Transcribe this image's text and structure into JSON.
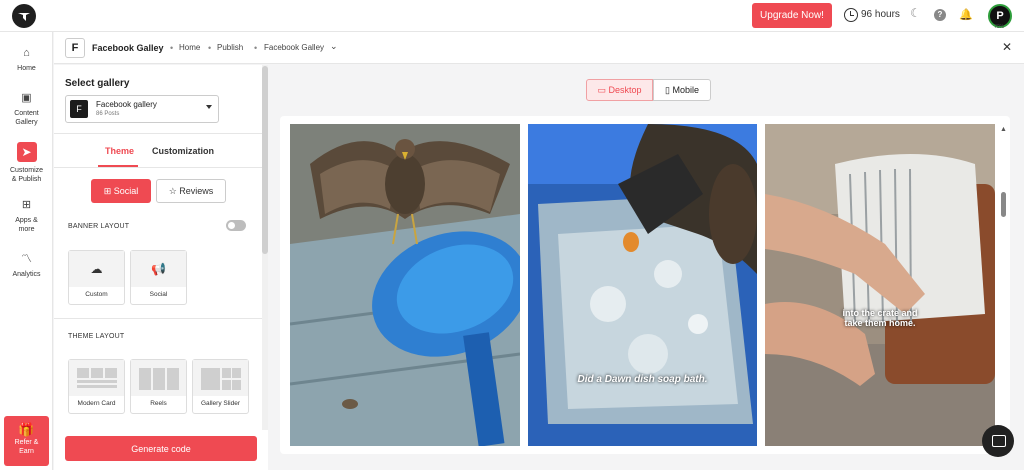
{
  "topbar": {
    "upgrade_label": "Upgrade Now!",
    "hours": "96 hours",
    "avatar_initial": "P",
    "profile_progress": "70%"
  },
  "nav": {
    "items": [
      {
        "label": "Home",
        "icon": "home-icon"
      },
      {
        "label": "Content\nGallery",
        "icon": "image-icon"
      },
      {
        "label": "Customize\n& Publish",
        "icon": "send-icon"
      },
      {
        "label": "Apps &\nmore",
        "icon": "grid-icon"
      },
      {
        "label": "Analytics",
        "icon": "chart-icon"
      }
    ],
    "refer_label": "Refer &\nEarn"
  },
  "breadcrumb": {
    "badge": "F",
    "title": "Facebook Galley",
    "home": "Home",
    "publish": "Publish",
    "current": "Facebook Galley"
  },
  "panel": {
    "select_label": "Select gallery",
    "gallery_badge": "F",
    "gallery_name": "Facebook gallery",
    "gallery_posts": "86 Posts",
    "tab_theme": "Theme",
    "tab_customization": "Customization",
    "btn_social": "Social",
    "btn_reviews": "Reviews",
    "banner_layout_label": "BANNER LAYOUT",
    "banner_layout_enabled": false,
    "banner_cards": [
      "Custom",
      "Social"
    ],
    "theme_layout_label": "THEME LAYOUT",
    "theme_cards": [
      "Modern Card",
      "Reels",
      "Gallery Slider"
    ],
    "generate_label": "Generate code"
  },
  "preview": {
    "device_desktop": "Desktop",
    "device_mobile": "Mobile",
    "active_device": "Desktop",
    "posts": [
      {
        "caption": ""
      },
      {
        "caption": "Did a Dawn dish soap bath."
      },
      {
        "caption": "into the crate and\ntake them home."
      }
    ]
  },
  "colors": {
    "accent": "#ef4a52",
    "sidebar_bg": "#ffffff",
    "page_bg": "#f4f4f5"
  }
}
